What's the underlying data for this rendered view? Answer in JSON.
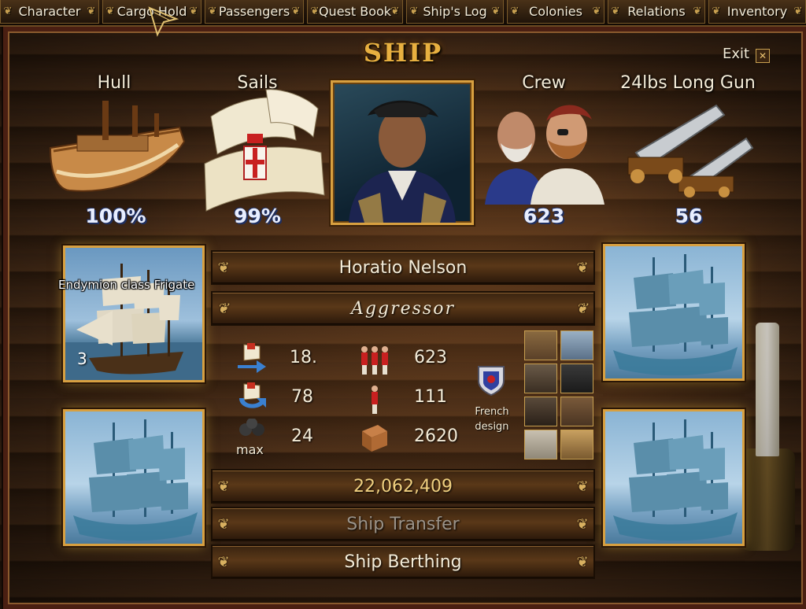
{
  "tabs": [
    {
      "label": "Character"
    },
    {
      "label": "Cargo Hold"
    },
    {
      "label": "Passengers"
    },
    {
      "label": "Quest Book"
    },
    {
      "label": "Ship's Log"
    },
    {
      "label": "Colonies"
    },
    {
      "label": "Relations"
    },
    {
      "label": "Inventory"
    }
  ],
  "title": "SHIP",
  "exit_label": "Exit",
  "stats_top": {
    "hull": {
      "label": "Hull",
      "value": "100%"
    },
    "sails": {
      "label": "Sails",
      "value": "99%"
    },
    "crew": {
      "label": "Crew",
      "value": "623"
    },
    "cannon": {
      "label": "24lbs Long Gun",
      "value": "56"
    }
  },
  "captain_name": "Horatio Nelson",
  "ship_name": "Aggressor",
  "ship_class": "Endymion class Frigate",
  "ship_count": "3",
  "stats": {
    "speed": "18.",
    "turn": "78",
    "cannons": "24",
    "cannons_icon_caption": "max",
    "crew_max": "623",
    "crew_min": "111",
    "capacity": "2620"
  },
  "design": {
    "line1": "French",
    "line2": "design"
  },
  "money": "22,062,409",
  "buttons": {
    "ship_transfer": "Ship Transfer",
    "ship_berthing": "Ship Berthing"
  },
  "colors": {
    "gold": "#d8a040",
    "title": "#e8b040",
    "text": "#f4ecd8",
    "disabled": "#9a9288"
  }
}
